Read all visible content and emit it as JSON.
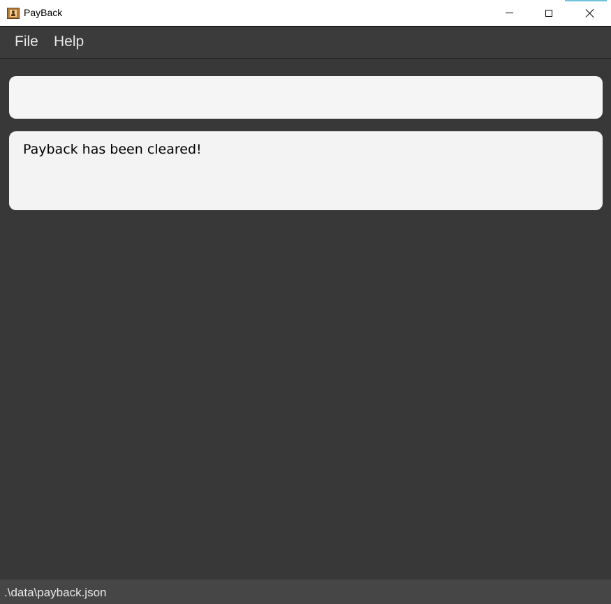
{
  "window": {
    "title": "PayBack"
  },
  "menu": {
    "items": [
      {
        "label": "File"
      },
      {
        "label": "Help"
      }
    ]
  },
  "command": {
    "value": "",
    "placeholder": ""
  },
  "result": {
    "message": "Payback has been cleared!"
  },
  "status": {
    "save_location": ".\\data\\payback.json"
  },
  "colors": {
    "background": "#383838",
    "menubar": "#3b3b3b",
    "panel": "#f5f5f5",
    "statusbar": "#464646",
    "titlebar": "#ffffff"
  },
  "icons": {
    "app": "address-book-icon",
    "minimize": "minimize-icon",
    "maximize": "maximize-icon",
    "close": "close-icon"
  }
}
